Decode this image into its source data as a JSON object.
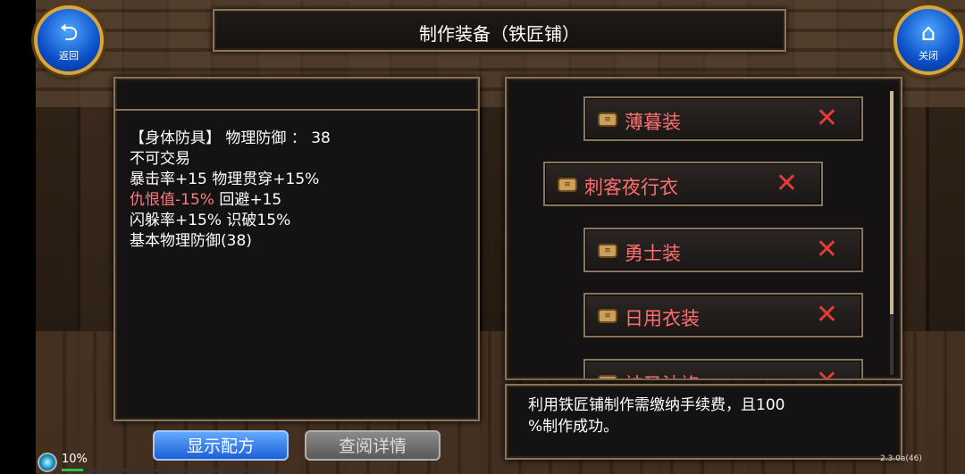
{
  "title": "制作装备（铁匠铺）",
  "buttons": {
    "back_label": "返回",
    "close_label": "关闭",
    "show_recipe": "显示配方",
    "view_details": "查阅详情"
  },
  "item_props": {
    "line1": "【身体防具】 物理防御 ：  38",
    "line2": "不可交易",
    "line3": "暴击率+15 物理贯穿+15%",
    "line4_red": "仇恨值-15%",
    "line4_rest": " 回避+15",
    "line5": "闪躲率+15% 识破15%",
    "line6": "基本物理防御(38)"
  },
  "recipes": [
    {
      "name": "薄暮装"
    },
    {
      "name": "刺客夜行衣"
    },
    {
      "name": "勇士装"
    },
    {
      "name": "日用衣装"
    },
    {
      "name": "神圣法袍"
    }
  ],
  "info": {
    "line1": "利用铁匠铺制作需缴纳手续费，且100",
    "line2": "%制作成功。"
  },
  "status": {
    "percent": "10%",
    "progress": 0.1,
    "version": "2.3.0a(46)"
  },
  "icons": {
    "back": "back-arrow-icon",
    "close": "home-icon",
    "recipe": "scroll-icon",
    "delete": "close-x-icon"
  },
  "colors": {
    "recipe_text": "#ff6f6f",
    "close_x": "#e53a3a",
    "primary_button": "#1b5fd6"
  }
}
